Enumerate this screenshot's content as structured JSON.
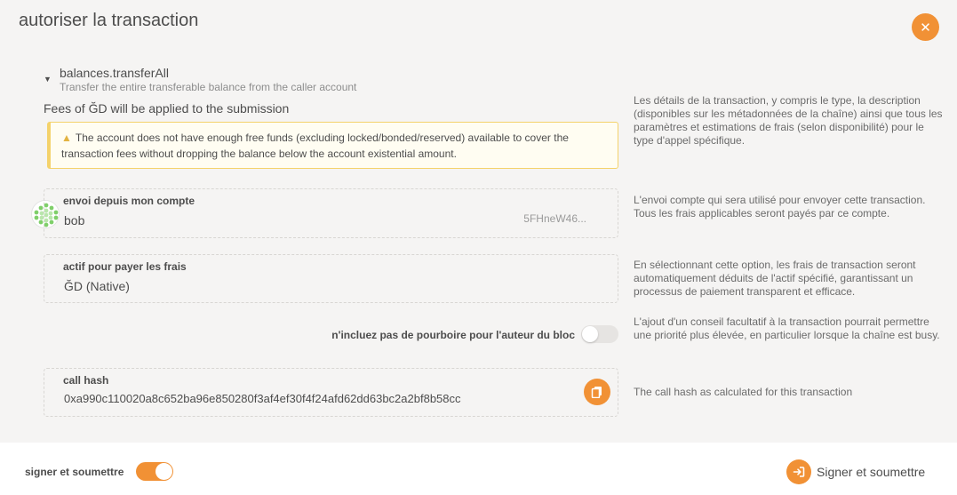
{
  "modal": {
    "title": "autoriser la transaction",
    "close_icon": "close-icon"
  },
  "call": {
    "name": "balances.transferAll",
    "description": "Transfer the entire transferable balance from the caller account",
    "fees": "Fees of ĞD will be applied to the submission"
  },
  "warning": {
    "icon": "warning-icon",
    "text": "The account does not have enough free funds (excluding locked/bonded/reserved) available to cover the transaction fees without dropping the balance below the account existential amount."
  },
  "help": {
    "details": "Les détails de la transaction, y compris le type, la description (disponibles sur les métadonnées de la chaîne) ainsi que tous les paramètres et estimations de frais (selon disponibilité) pour le type d'appel spécifique.",
    "sender": "L'envoi compte qui sera utilisé pour envoyer cette transaction. Tous les frais applicables seront payés par ce compte.",
    "asset": "En sélectionnant cette option, les frais de transaction seront automatiquement déduits de l'actif spécifié, garantissant un processus de paiement transparent et efficace.",
    "tip": "L'ajout d'un conseil facultatif à la transaction pourrait permettre une priorité plus élevée, en particulier lorsque la chaîne est busy.",
    "call_hash": "The call hash as calculated for this transaction"
  },
  "sender": {
    "label": "envoi depuis mon compte",
    "name": "bob",
    "address": "5FHneW46..."
  },
  "asset": {
    "label": "actif pour payer les frais",
    "value": "ĞD (Native)"
  },
  "tip": {
    "label": "n'incluez pas de pourboire pour l'auteur du bloc",
    "enabled": false
  },
  "call_hash": {
    "label": "call hash",
    "value": "0xa990c110020a8c652ba96e850280f3af4ef30f4f24afd62dd63bc2a2bf8b58cc",
    "copy_icon": "copy-icon"
  },
  "footer": {
    "sign_toggle_label": "signer et soumettre",
    "sign_toggle_on": true,
    "submit_label": "Signer et soumettre",
    "submit_icon": "sign-in-icon"
  },
  "colors": {
    "accent": "#f19135",
    "warning_border": "#f4d26b",
    "background": "#f5f4f3"
  }
}
